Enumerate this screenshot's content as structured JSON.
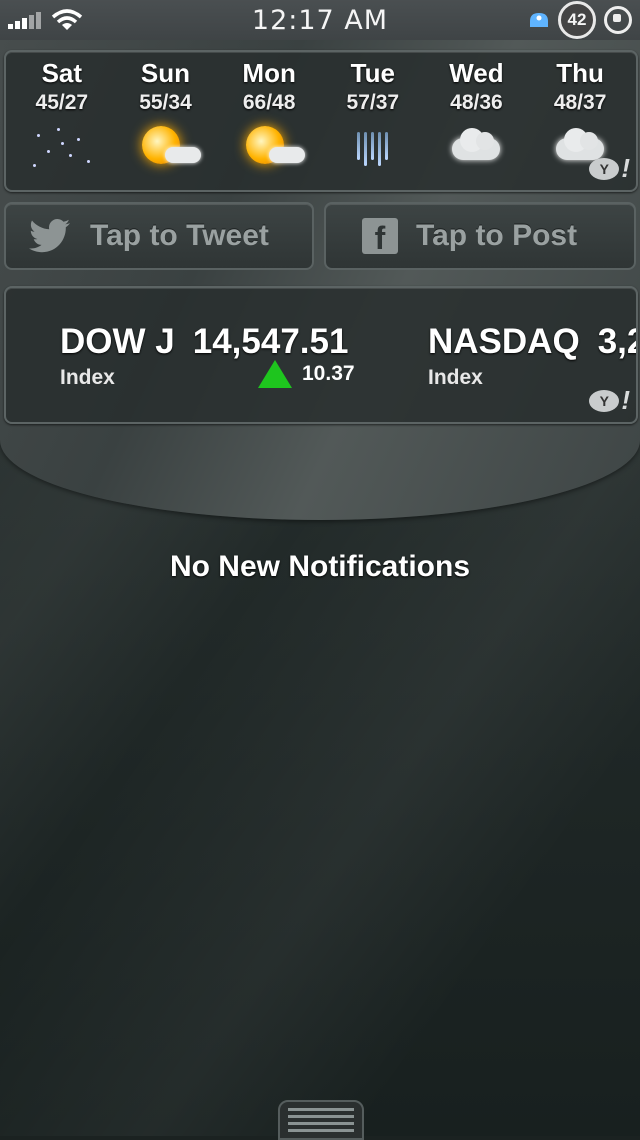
{
  "status_bar": {
    "time": "12:17 AM",
    "badge_count": "42",
    "icons": [
      "signal-icon",
      "wifi-icon",
      "notification-bubble-icon",
      "rotation-lock-icon"
    ]
  },
  "weather": {
    "days": [
      {
        "day": "Sat",
        "temps": "45/27",
        "icon": "clear-night-icon"
      },
      {
        "day": "Sun",
        "temps": "55/34",
        "icon": "partly-sunny-icon"
      },
      {
        "day": "Mon",
        "temps": "66/48",
        "icon": "partly-sunny-icon"
      },
      {
        "day": "Tue",
        "temps": "57/37",
        "icon": "rain-icon"
      },
      {
        "day": "Wed",
        "temps": "48/36",
        "icon": "cloudy-icon"
      },
      {
        "day": "Thu",
        "temps": "48/37",
        "icon": "cloudy-icon"
      }
    ],
    "provider_logo": "yahoo-icon",
    "provider_text": "Y",
    "provider_mark": "!"
  },
  "share": {
    "tweet_label": "Tap to Tweet",
    "post_label": "Tap to Post",
    "fb_letter": "f"
  },
  "stocks": {
    "items": [
      {
        "symbol": "DOW J",
        "value": "14,547.51",
        "type": "Index",
        "change": "10.37",
        "direction": "up"
      },
      {
        "symbol": "NASDAQ",
        "value": "3,2",
        "type": "Index"
      }
    ],
    "provider_text": "Y",
    "provider_mark": "!"
  },
  "notifications": {
    "empty_message": "No New Notifications"
  }
}
